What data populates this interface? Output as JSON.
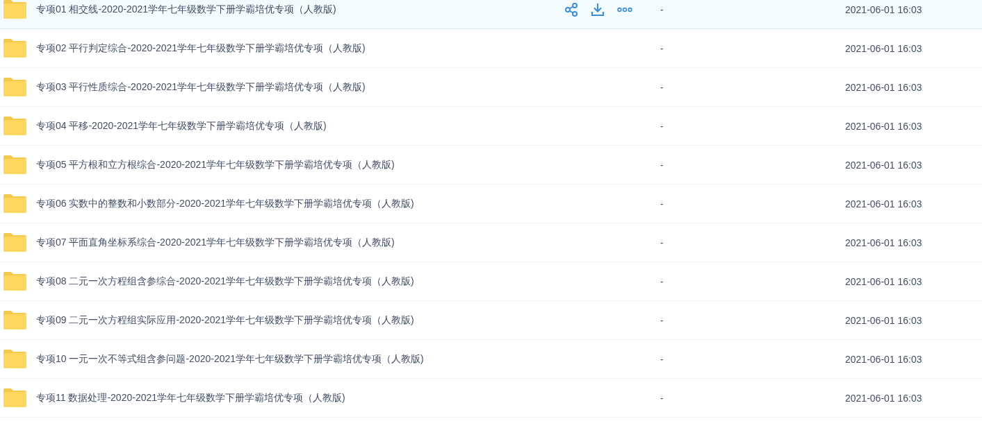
{
  "files": [
    {
      "name": "专项01 相交线-2020-2021学年七年级数学下册学霸培优专项（人教版)",
      "size": "-",
      "modified": "2021-06-01 16:03",
      "selected": true
    },
    {
      "name": "专项02 平行判定综合-2020-2021学年七年级数学下册学霸培优专项（人教版)",
      "size": "-",
      "modified": "2021-06-01 16:03",
      "selected": false
    },
    {
      "name": "专项03 平行性质综合-2020-2021学年七年级数学下册学霸培优专项（人教版)",
      "size": "-",
      "modified": "2021-06-01 16:03",
      "selected": false
    },
    {
      "name": "专项04 平移-2020-2021学年七年级数学下册学霸培优专项（人教版)",
      "size": "-",
      "modified": "2021-06-01 16:03",
      "selected": false
    },
    {
      "name": "专项05 平方根和立方根综合-2020-2021学年七年级数学下册学霸培优专项（人教版)",
      "size": "-",
      "modified": "2021-06-01 16:03",
      "selected": false
    },
    {
      "name": "专项06 实数中的整数和小数部分-2020-2021学年七年级数学下册学霸培优专项（人教版)",
      "size": "-",
      "modified": "2021-06-01 16:03",
      "selected": false
    },
    {
      "name": "专项07 平面直角坐标系综合-2020-2021学年七年级数学下册学霸培优专项（人教版)",
      "size": "-",
      "modified": "2021-06-01 16:03",
      "selected": false
    },
    {
      "name": "专项08 二元一次方程组含参综合-2020-2021学年七年级数学下册学霸培优专项（人教版)",
      "size": "-",
      "modified": "2021-06-01 16:03",
      "selected": false
    },
    {
      "name": "专项09 二元一次方程组实际应用-2020-2021学年七年级数学下册学霸培优专项（人教版)",
      "size": "-",
      "modified": "2021-06-01 16:03",
      "selected": false
    },
    {
      "name": "专项10 一元一次不等式组含参问题-2020-2021学年七年级数学下册学霸培优专项（人教版)",
      "size": "-",
      "modified": "2021-06-01 16:03",
      "selected": false
    },
    {
      "name": "专项11 数据处理-2020-2021学年七年级数学下册学霸培优专项（人教版)",
      "size": "-",
      "modified": "2021-06-01 16:03",
      "selected": false
    }
  ]
}
